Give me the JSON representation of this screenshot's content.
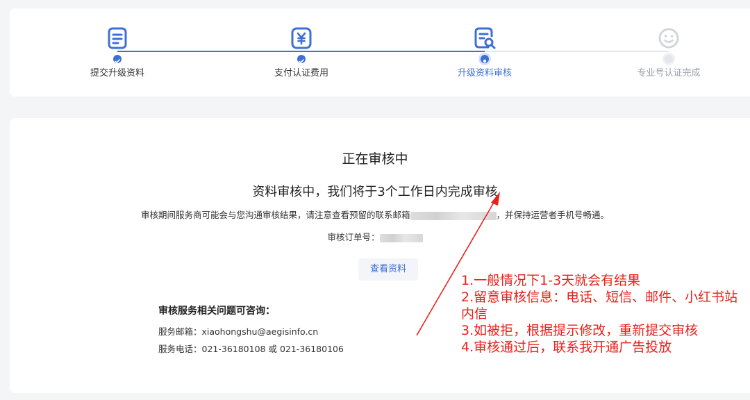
{
  "steps": [
    {
      "label": "提交升级资料",
      "icon": "document-icon",
      "state": "done"
    },
    {
      "label": "支付认证费用",
      "icon": "yuan-payment-icon",
      "state": "done"
    },
    {
      "label": "升级资料审核",
      "icon": "review-search-icon",
      "state": "current"
    },
    {
      "label": "专业号认证完成",
      "icon": "smile-icon",
      "state": "pending"
    }
  ],
  "colors": {
    "accent": "#3e6fd8",
    "pending": "#c8ccd4",
    "annotation": "#e8211a"
  },
  "review": {
    "title": "正在审核中",
    "subtitle": "资料审核中，我们将于3个工作日内完成审核",
    "notice_before": "审核期间服务商可能会与您沟通审核结果，请注意查看预留的联系邮箱",
    "notice_after": "，并保持运营者手机号畅通。",
    "order_label": "审核订单号：",
    "view_button": "查看资料"
  },
  "contact": {
    "title": "审核服务相关问题可咨询：",
    "email": "服务邮箱：xiaohongshu@aegisinfo.cn",
    "phone": "服务电话：021-36180108 或 021-36180106"
  },
  "annotation": [
    "1.一般情况下1-3天就会有结果",
    "2.留意审核信息：电话、短信、邮件、小红书站内信",
    "3.如被拒，根据提示修改，重新提交审核",
    "4.审核通过后，联系我开通广告投放"
  ]
}
